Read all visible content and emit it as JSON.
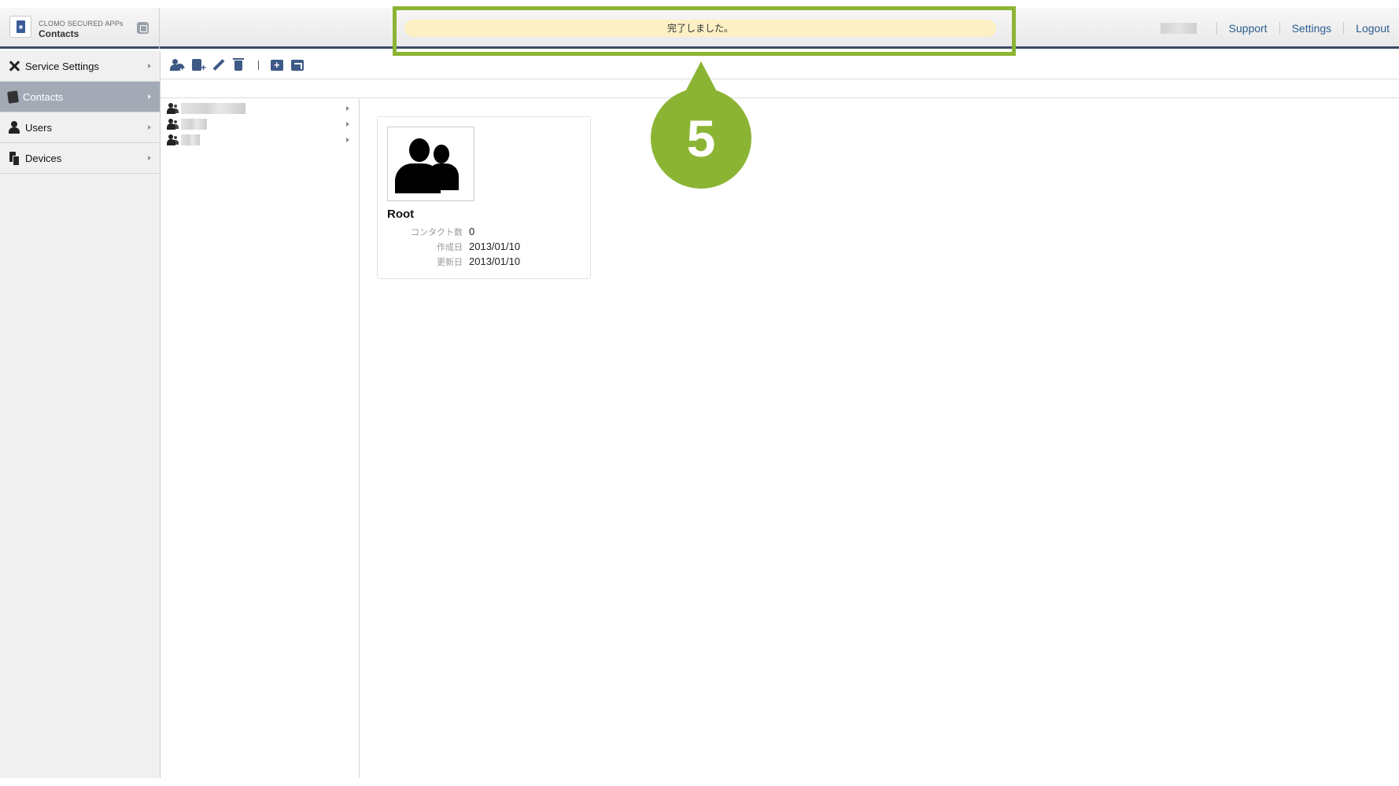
{
  "header": {
    "brand_sub": "CLOMO SECURED APPs",
    "brand_title": "Contacts",
    "notice": "完了しました。",
    "nav_links": [
      "Support",
      "Settings",
      "Logout"
    ]
  },
  "sidebar": {
    "items": [
      {
        "label": "Service Settings",
        "icon": "tools-icon",
        "active": false
      },
      {
        "label": "Contacts",
        "icon": "address-book-icon",
        "active": true
      },
      {
        "label": "Users",
        "icon": "user-icon",
        "active": false
      },
      {
        "label": "Devices",
        "icon": "devices-icon",
        "active": false
      }
    ]
  },
  "toolbar": {
    "buttons": [
      "add-contact-icon",
      "add-address-book-icon",
      "edit-icon",
      "delete-icon",
      "add-folder-icon",
      "move-folder-icon"
    ]
  },
  "tree": {
    "rows": 3
  },
  "card": {
    "title": "Root",
    "meta": [
      {
        "label": "コンタクト数",
        "value": "0"
      },
      {
        "label": "作成日",
        "value": "2013/01/10"
      },
      {
        "label": "更新日",
        "value": "2013/01/10"
      }
    ]
  },
  "annotation": {
    "step": "5",
    "color": "#8cb434"
  },
  "colors": {
    "accent": "#3b4a66",
    "active_nav": "#a3aab6",
    "notice_bg": "#fdf0c4",
    "link": "#2a5d8f"
  }
}
